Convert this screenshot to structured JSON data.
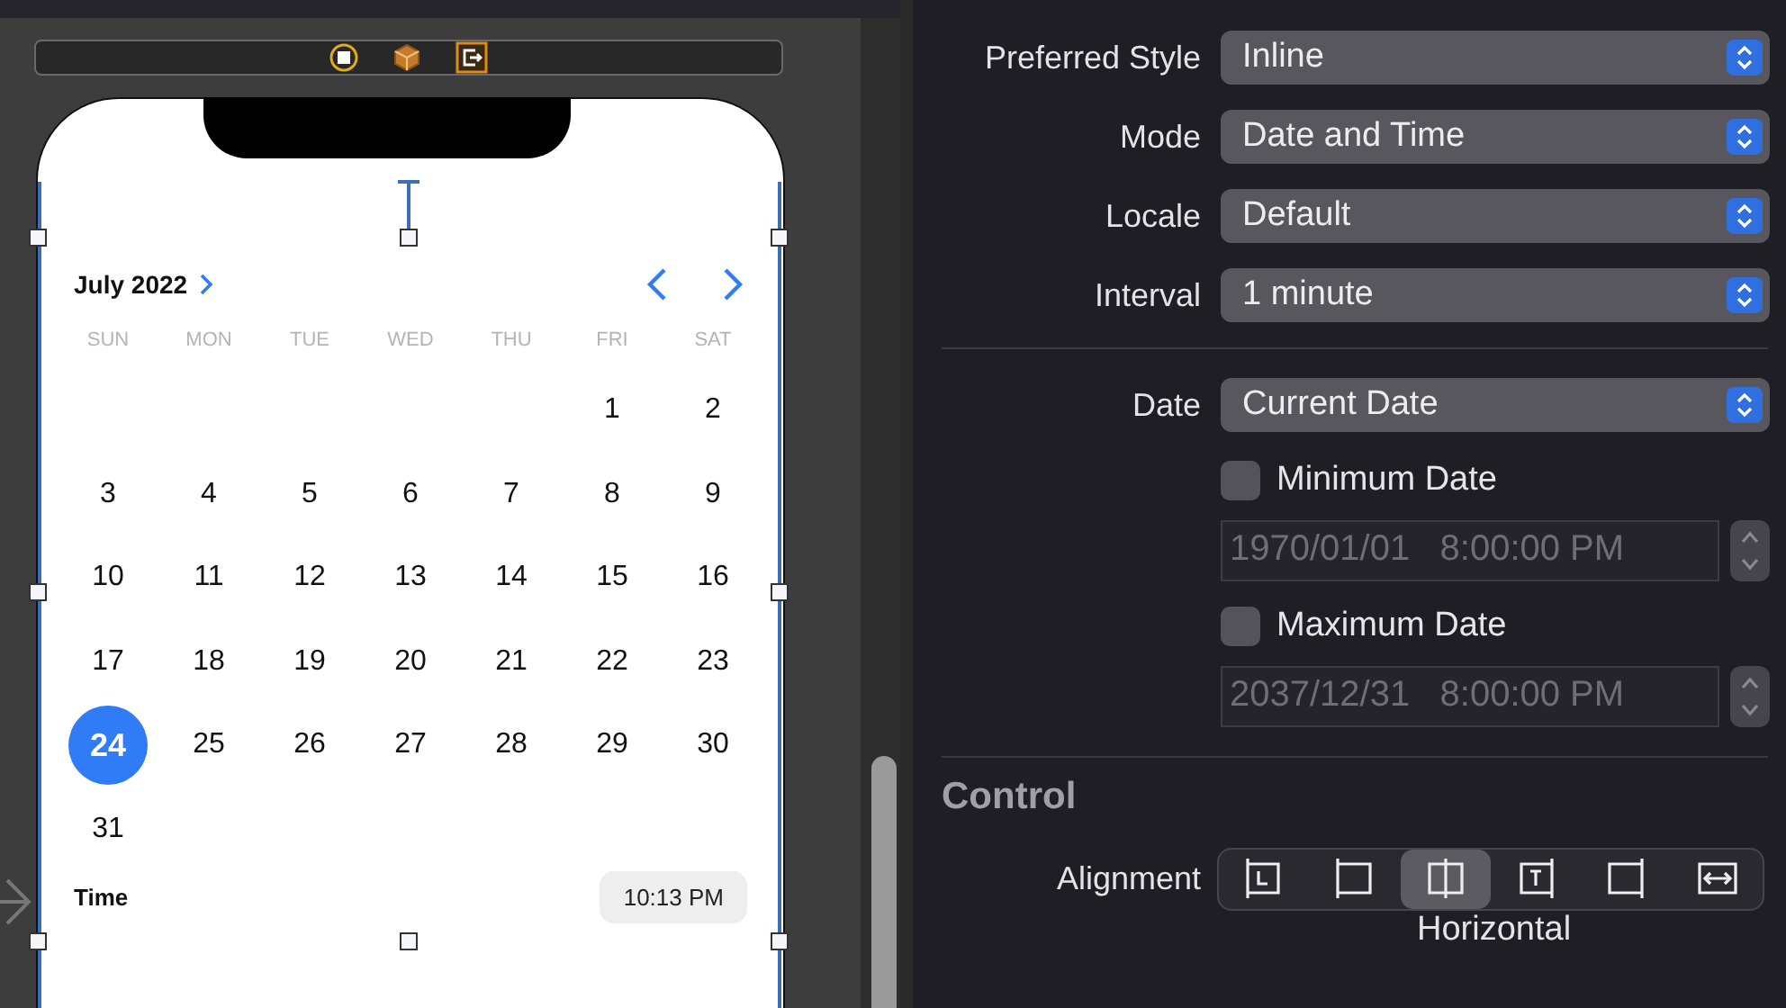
{
  "calendar": {
    "month": "July 2022",
    "weekdays": [
      "SUN",
      "MON",
      "TUE",
      "WED",
      "THU",
      "FRI",
      "SAT"
    ],
    "weeks": [
      {
        "days": [
          {
            "kind": "blank"
          },
          {
            "kind": "blank"
          },
          {
            "kind": "blank"
          },
          {
            "kind": "blank"
          },
          {
            "kind": "blank"
          },
          {
            "kind": "day",
            "label": "1",
            "selected": false
          },
          {
            "kind": "day",
            "label": "2",
            "selected": false
          }
        ]
      },
      {
        "days": [
          {
            "kind": "day",
            "label": "3",
            "selected": false
          },
          {
            "kind": "day",
            "label": "4",
            "selected": false
          },
          {
            "kind": "day",
            "label": "5",
            "selected": false
          },
          {
            "kind": "day",
            "label": "6",
            "selected": false
          },
          {
            "kind": "day",
            "label": "7",
            "selected": false
          },
          {
            "kind": "day",
            "label": "8",
            "selected": false
          },
          {
            "kind": "day",
            "label": "9",
            "selected": false
          }
        ]
      },
      {
        "days": [
          {
            "kind": "day",
            "label": "10",
            "selected": false
          },
          {
            "kind": "day",
            "label": "11",
            "selected": false
          },
          {
            "kind": "day",
            "label": "12",
            "selected": false
          },
          {
            "kind": "day",
            "label": "13",
            "selected": false
          },
          {
            "kind": "day",
            "label": "14",
            "selected": false
          },
          {
            "kind": "day",
            "label": "15",
            "selected": false
          },
          {
            "kind": "day",
            "label": "16",
            "selected": false
          }
        ]
      },
      {
        "days": [
          {
            "kind": "day",
            "label": "17",
            "selected": false
          },
          {
            "kind": "day",
            "label": "18",
            "selected": false
          },
          {
            "kind": "day",
            "label": "19",
            "selected": false
          },
          {
            "kind": "day",
            "label": "20",
            "selected": false
          },
          {
            "kind": "day",
            "label": "21",
            "selected": false
          },
          {
            "kind": "day",
            "label": "22",
            "selected": false
          },
          {
            "kind": "day",
            "label": "23",
            "selected": false
          }
        ]
      },
      {
        "days": [
          {
            "kind": "day",
            "label": "24",
            "selected": true
          },
          {
            "kind": "day",
            "label": "25",
            "selected": false
          },
          {
            "kind": "day",
            "label": "26",
            "selected": false
          },
          {
            "kind": "day",
            "label": "27",
            "selected": false
          },
          {
            "kind": "day",
            "label": "28",
            "selected": false
          },
          {
            "kind": "day",
            "label": "29",
            "selected": false
          },
          {
            "kind": "day",
            "label": "30",
            "selected": false
          }
        ]
      },
      {
        "days": [
          {
            "kind": "day",
            "label": "31",
            "selected": false
          }
        ]
      }
    ],
    "time_label": "Time",
    "time": "10:13 PM"
  },
  "inspector": {
    "popups": [
      {
        "label": "Preferred Style",
        "value": "Inline"
      },
      {
        "label": "Mode",
        "value": "Date and Time"
      },
      {
        "label": "Locale",
        "value": "Default"
      },
      {
        "label": "Interval",
        "value": "1 minute"
      }
    ],
    "date": {
      "label": "Date",
      "value": "Current Date"
    },
    "limits": [
      {
        "label": "Minimum Date",
        "checked": false,
        "value": "1970/01/01   8:00:00 PM",
        "disabled": true
      },
      {
        "label": "Maximum Date",
        "checked": false,
        "value": "2037/12/31   8:00:00 PM",
        "disabled": true
      }
    ],
    "section": "Control",
    "alignment": {
      "label": "Alignment",
      "caption": "Horizontal",
      "options": [
        {
          "kind": "leading",
          "selected": false
        },
        {
          "kind": "left",
          "selected": false
        },
        {
          "kind": "center",
          "selected": true
        },
        {
          "kind": "trailing",
          "selected": false
        },
        {
          "kind": "right",
          "selected": false
        },
        {
          "kind": "fill",
          "selected": false
        }
      ]
    }
  }
}
